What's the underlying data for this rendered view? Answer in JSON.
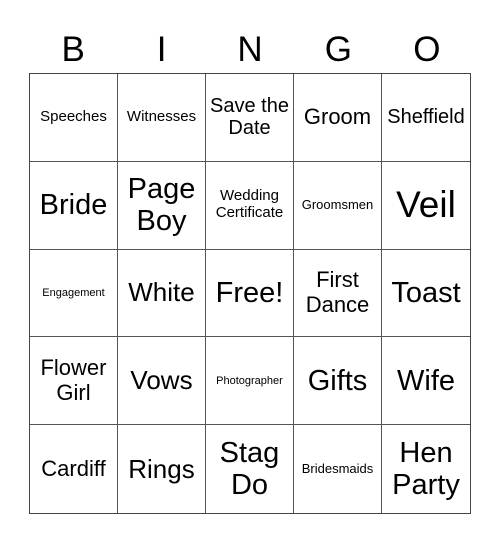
{
  "header": {
    "letters": [
      "B",
      "I",
      "N",
      "G",
      "O"
    ]
  },
  "cells": [
    {
      "text": "Speeches",
      "size": "s-sm"
    },
    {
      "text": "Witnesses",
      "size": "s-sm"
    },
    {
      "text": "Save the Date",
      "size": "s-m"
    },
    {
      "text": "Groom",
      "size": "s-ml"
    },
    {
      "text": "Sheffield",
      "size": "s-m"
    },
    {
      "text": "Bride",
      "size": "s-xl"
    },
    {
      "text": "Page Boy",
      "size": "s-xl"
    },
    {
      "text": "Wedding Certificate",
      "size": "s-sm"
    },
    {
      "text": "Groomsmen",
      "size": "s-s"
    },
    {
      "text": "Veil",
      "size": "s-xxl"
    },
    {
      "text": "Engagement",
      "size": "s-xs"
    },
    {
      "text": "White",
      "size": "s-l"
    },
    {
      "text": "Free!",
      "size": "s-xl"
    },
    {
      "text": "First Dance",
      "size": "s-ml"
    },
    {
      "text": "Toast",
      "size": "s-xl"
    },
    {
      "text": "Flower Girl",
      "size": "s-ml"
    },
    {
      "text": "Vows",
      "size": "s-l"
    },
    {
      "text": "Photographer",
      "size": "s-xs"
    },
    {
      "text": "Gifts",
      "size": "s-xl"
    },
    {
      "text": "Wife",
      "size": "s-xl"
    },
    {
      "text": "Cardiff",
      "size": "s-ml"
    },
    {
      "text": "Rings",
      "size": "s-l"
    },
    {
      "text": "Stag Do",
      "size": "s-xl"
    },
    {
      "text": "Bridesmaids",
      "size": "s-s"
    },
    {
      "text": "Hen Party",
      "size": "s-xl"
    }
  ]
}
